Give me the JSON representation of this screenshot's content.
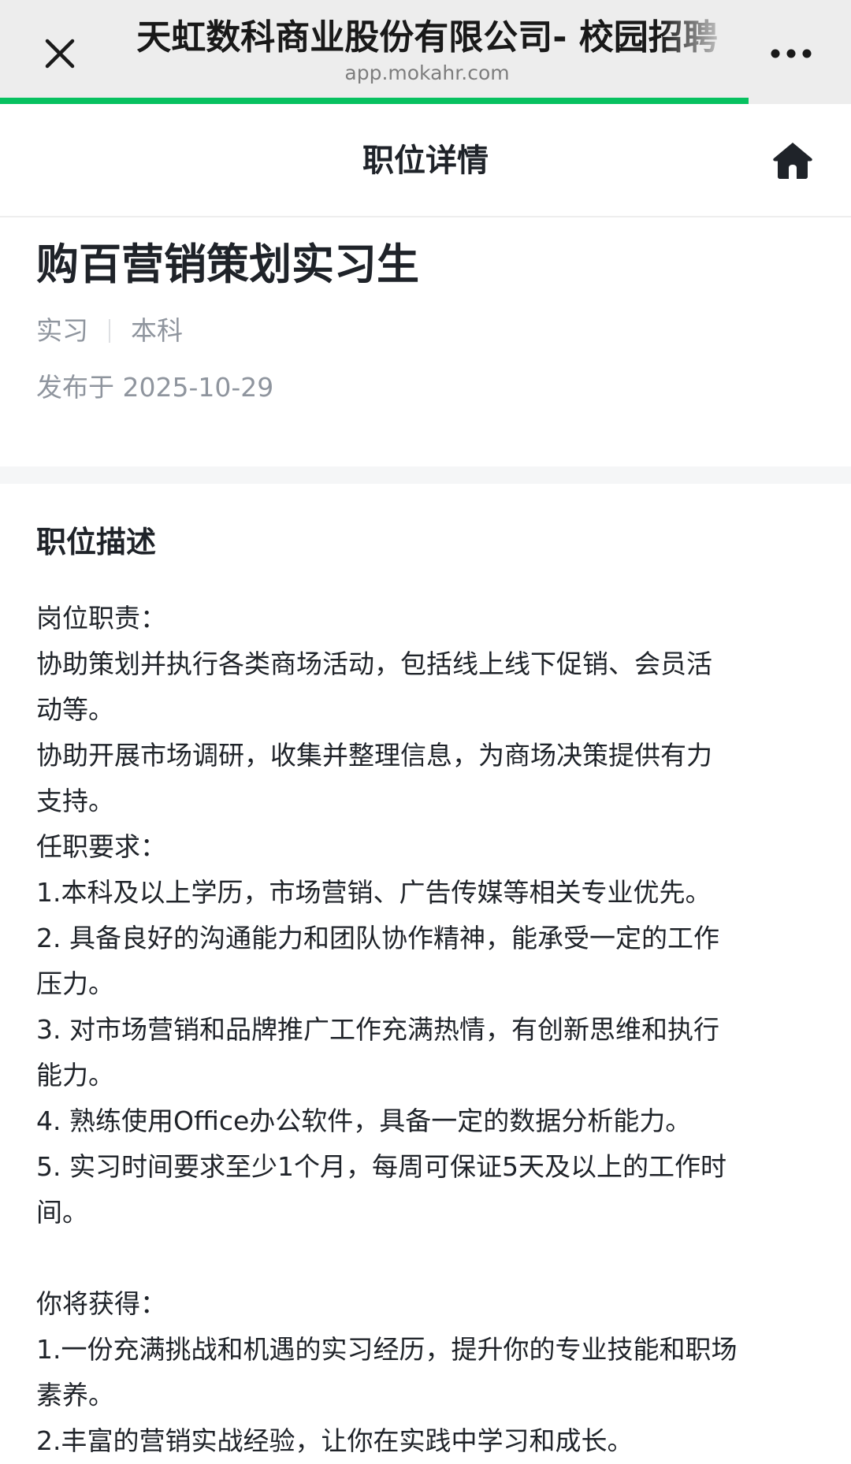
{
  "browser": {
    "page_title": "天虹数科商业股份有限公司- 校园招聘",
    "url": "app.mokahr.com",
    "load_progress_pct": 88
  },
  "header": {
    "title": "职位详情"
  },
  "job": {
    "title": "购百营销策划实习生",
    "tags": [
      "实习",
      "本科"
    ],
    "published": "发布于 2025-10-29"
  },
  "description": {
    "heading": "职位描述",
    "lines": [
      "岗位职责：",
      "协助策划并执行各类商场活动，包括线上线下促销、会员活",
      "动等。",
      "协助开展市场调研，收集并整理信息，为商场决策提供有力",
      "支持。",
      "任职要求：",
      "1.本科及以上学历，市场营销、广告传媒等相关专业优先。",
      "2. 具备良好的沟通能力和团队协作精神，能承受一定的工作",
      "压力。",
      "3. 对市场营销和品牌推广工作充满热情，有创新思维和执行",
      "能力。",
      "4. 熟练使用Office办公软件，具备一定的数据分析能力。",
      "5. 实习时间要求至少1个月，每周可保证5天及以上的工作时",
      "间。",
      "",
      "你将获得：",
      "1.一份充满挑战和机遇的实习经历，提升你的专业技能和职场",
      "素养。",
      "2.丰富的营销实战经验，让你在实践中学习和成长。"
    ]
  }
}
